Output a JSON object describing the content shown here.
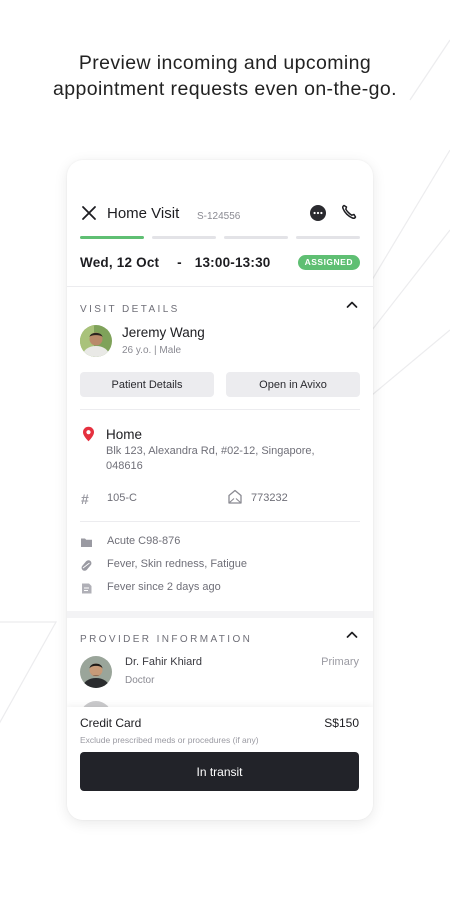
{
  "headline": {
    "line1": "Preview incoming and upcoming",
    "line2": "appointment requests even on-the-go."
  },
  "visit": {
    "title": "Home Visit",
    "id": "S-124556",
    "progress_done": 1,
    "progress_total": 4
  },
  "schedule": {
    "date": "Wed, 12 Oct",
    "separator": "-",
    "time": "13:00-13:30",
    "status": "ASSIGNED"
  },
  "visit_details": {
    "section_title": "VISIT DETAILS",
    "patient_name": "Jeremy Wang",
    "patient_meta": "26 y.o. | Male",
    "patient_details_btn": "Patient Details",
    "open_avixo_btn": "Open in Avixo",
    "location_title": "Home",
    "address": "Blk 123, Alexandra Rd, #02-12, Singapore, 048616",
    "unit": "105-C",
    "postal": "773232",
    "diagnosis": "Acute C98-876",
    "symptoms": "Fever, Skin redness, Fatigue",
    "note": "Fever since 2 days ago"
  },
  "provider": {
    "section_title": "PROVIDER INFORMATION",
    "name": "Dr. Fahir Khiard",
    "role": "Doctor",
    "tag": "Primary"
  },
  "payment": {
    "method": "Credit Card",
    "amount": "S$150",
    "note": "Exclude prescribed meds or procedures (if any)",
    "action": "In transit"
  },
  "colors": {
    "accent_green": "#5fbf73",
    "pin_red": "#e5303f",
    "button_dark": "#222329"
  }
}
